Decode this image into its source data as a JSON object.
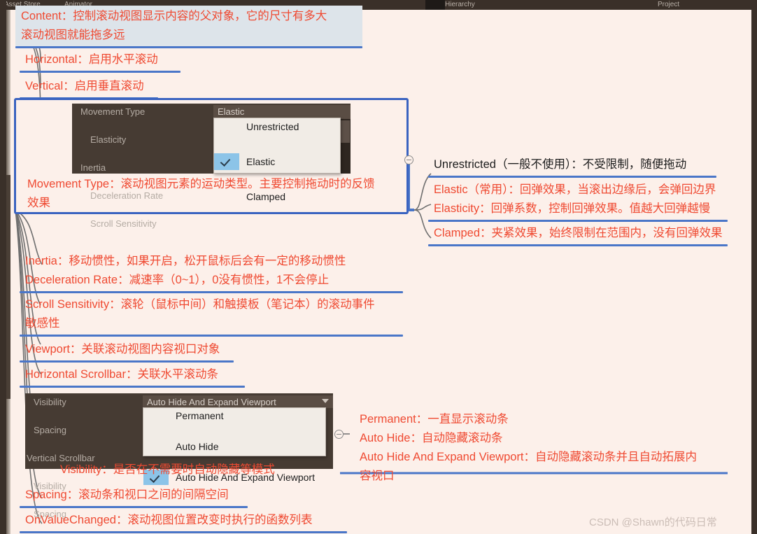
{
  "app": {
    "background_color": "#fcf0ea",
    "node_text_color": "#ef4a32",
    "node_underline_color": "#4a76c8",
    "frame_color": "#3a63c0"
  },
  "unity_tabs": [
    {
      "label": "Asset Store"
    },
    {
      "label": "Animator"
    },
    {
      "label": "Hierarchy"
    },
    {
      "label": "Project"
    }
  ],
  "nodes": {
    "content": "Content：控制滚动视图显示内容的父对象，它的尺寸有多大\n滚动视图就能拖多远",
    "horizontal": "Horizontal：启用水平滚动",
    "vertical": "Vertical：启用垂直滚动",
    "movement_type": "Movement Type：滚动视图元素的运动类型。主要控制拖动时的反馈\n效果",
    "inertia": "Inertia：移动惯性，如果开启，松开鼠标后会有一定的移动惯性\nDeceleration Rate：减速率（0~1），0没有惯性，1不会停止",
    "scroll_sensitivity": "Scroll Sensitivity：滚轮（鼠标中间）和触摸板（笔记本）的滚动事件\n敏感性",
    "viewport": "Viewport：关联滚动视图内容视口对象",
    "horizontal_scrollbar": "Horizontal Scrollbar：关联水平滚动条",
    "visibility": "Visibility：是否在不需要时自动隐藏等模式",
    "spacing": "Spacing：滚动条和视口之间的间隔空间",
    "on_value_changed": "OnValueChanged：滚动视图位置改变时执行的函数列表",
    "unrestricted": "Unrestricted（一般不使用）：不受限制，随便拖动",
    "elastic": "Elastic（常用）：回弹效果，当滚出边缘后，会弹回边界\nElasticity：回弹系数，控制回弹效果。值越大回弹越慢",
    "clamped": "Clamped：夹紧效果，始终限制在范围内，没有回弹效果",
    "visibility_modes": "Permanent：一直显示滚动条\nAuto Hide：自动隐藏滚动条\nAuto Hide And Expand Viewport：自动隐藏滚动条并且自动拓展内\n容视口"
  },
  "inspector_movement": {
    "rows": [
      {
        "label": "Movement Type",
        "indent": false
      },
      {
        "label": "Elasticity",
        "indent": true
      },
      {
        "label": "Inertia",
        "indent": false
      },
      {
        "label": "Deceleration Rate",
        "indent": true
      },
      {
        "label": "Scroll Sensitivity",
        "indent": true
      }
    ],
    "selected_value": "Elastic",
    "options": [
      {
        "label": "Unrestricted",
        "checked": false
      },
      {
        "label": "Elastic",
        "checked": true
      },
      {
        "label": "Clamped",
        "checked": false
      }
    ]
  },
  "inspector_visibility": {
    "rows": [
      {
        "label": "Visibility",
        "indent": true
      },
      {
        "label": "Spacing",
        "indent": true
      },
      {
        "label": "Vertical Scrollbar",
        "indent": false
      },
      {
        "label": "Visibility",
        "indent": true
      },
      {
        "label": "Spacing",
        "indent": true
      }
    ],
    "selected_value": "Auto Hide And Expand Viewport",
    "options": [
      {
        "label": "Permanent",
        "checked": false
      },
      {
        "label": "Auto Hide",
        "checked": false
      },
      {
        "label": "Auto Hide And Expand Viewport",
        "checked": true
      }
    ]
  },
  "watermark": "CSDN @Shawn的代码日常"
}
